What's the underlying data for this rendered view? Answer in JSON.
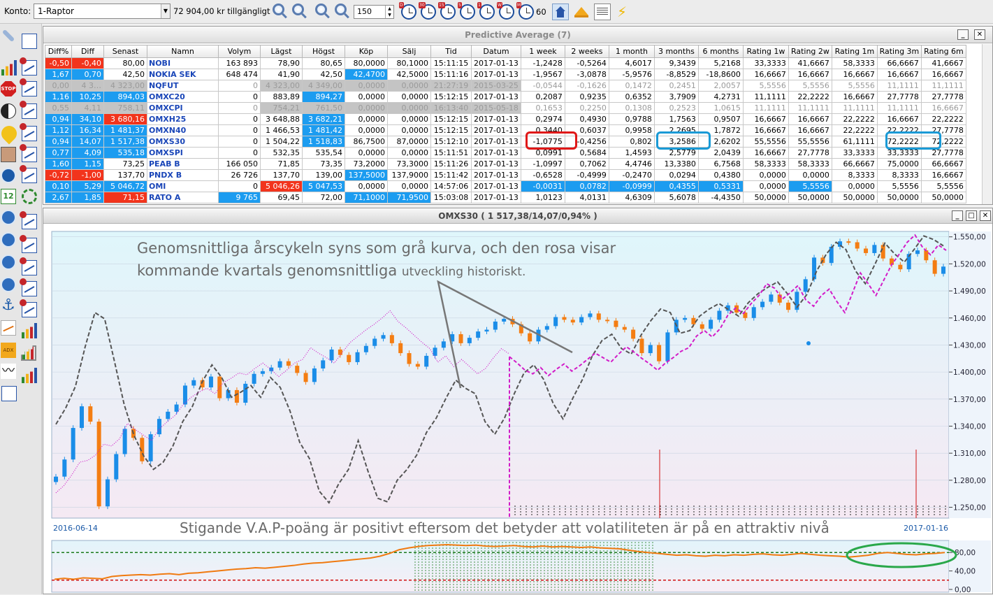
{
  "toolbar": {
    "konto_label": "Konto:",
    "account": "1-Raptor",
    "available": "72 904,00 kr tillgängligt",
    "count_value": "150",
    "clock_badges": [
      "D",
      "30",
      "15",
      "5",
      "1",
      "W",
      "M",
      ""
    ],
    "interval": "60"
  },
  "table_window": {
    "title": "Predictive Average (7)"
  },
  "columns": [
    "Diff%",
    "Diff",
    "Senast",
    "Namn",
    "Volym",
    "Lägst",
    "Högst",
    "Köp",
    "Sälj",
    "Tid",
    "Datum",
    "1 week",
    "2 weeks",
    "1 month",
    "3 months",
    "6 months",
    "Rating 1w",
    "Rating 2w",
    "Rating 1m",
    "Rating 3m",
    "Rating 6m"
  ],
  "rows": [
    {
      "cells": [
        "-0,50",
        "-0,40",
        "80,00",
        "NOBI",
        "163 893",
        "78,90",
        "80,65",
        "80,0000",
        "80,1000",
        "15:11:15",
        "2017-01-13",
        "-1,2428",
        "-0,5264",
        "4,6017",
        "9,3439",
        "5,2168",
        "33,3333",
        "41,6667",
        "58,3333",
        "66,6667",
        "41,6667"
      ],
      "fills": {
        "0": "red",
        "1": "red"
      }
    },
    {
      "cells": [
        "1,67",
        "0,70",
        "42,50",
        "NOKIA SEK",
        "648 474",
        "41,90",
        "42,50",
        "42,4700",
        "42,5000",
        "15:11:16",
        "2017-01-13",
        "-1,9567",
        "-3,0878",
        "-5,9576",
        "-8,8529",
        "-18,8600",
        "16,6667",
        "16,6667",
        "16,6667",
        "16,6667",
        "16,6667"
      ],
      "fills": {
        "0": "blue",
        "1": "blue",
        "7": "blue"
      }
    },
    {
      "cells": [
        "0,00",
        "4 3…",
        "4 323,00",
        "NQFUT",
        "0",
        "4 323,00",
        "4 349,00",
        "0,0000",
        "0,0000",
        "21:27:19",
        "2015-03-25",
        "-0,0544",
        "-0,1626",
        "0,1472",
        "0,2451",
        "2,0057",
        "5,5556",
        "5,5556",
        "5,5556",
        "11,1111",
        "11,1111"
      ],
      "fills": {
        "0": "gray",
        "1": "gray",
        "2": "gray",
        "5": "gray",
        "6": "gray",
        "7": "gray",
        "8": "gray",
        "9": "gray",
        "10": "gray"
      },
      "stale": true
    },
    {
      "cells": [
        "1,16",
        "10,25",
        "894,03",
        "OMXC20",
        "0",
        "883,89",
        "894,27",
        "0,0000",
        "0,0000",
        "15:12:15",
        "2017-01-13",
        "0,2087",
        "0,9235",
        "0,6352",
        "3,7909",
        "4,2731",
        "11,1111",
        "22,2222",
        "16,6667",
        "27,7778",
        "27,7778"
      ],
      "fills": {
        "0": "blue",
        "1": "blue",
        "2": "blue",
        "6": "blue"
      }
    },
    {
      "cells": [
        "0,55",
        "4,11",
        "758,11",
        "OMXCPI",
        "0",
        "754,21",
        "761,50",
        "0,0000",
        "0,0000",
        "16:13:40",
        "2015-05-18",
        "0,1653",
        "0,2250",
        "0,1308",
        "0,2523",
        "1,0615",
        "11,1111",
        "11,1111",
        "11,1111",
        "11,1111",
        "16,6667"
      ],
      "fills": {
        "0": "gray",
        "1": "gray",
        "2": "gray",
        "5": "gray",
        "6": "gray",
        "7": "gray",
        "8": "gray",
        "9": "gray",
        "10": "gray"
      },
      "stale": true
    },
    {
      "cells": [
        "0,94",
        "34,10",
        "3 680,16",
        "OMXH25",
        "0",
        "3 648,88",
        "3 682,21",
        "0,0000",
        "0,0000",
        "15:12:15",
        "2017-01-13",
        "0,2974",
        "0,4930",
        "0,9788",
        "1,7563",
        "0,9507",
        "16,6667",
        "16,6667",
        "22,2222",
        "16,6667",
        "22,2222"
      ],
      "fills": {
        "0": "blue",
        "1": "blue",
        "2": "red",
        "6": "blue"
      }
    },
    {
      "cells": [
        "1,12",
        "16,34",
        "1 481,37",
        "OMXN40",
        "0",
        "1 466,53",
        "1 481,42",
        "0,0000",
        "0,0000",
        "15:12:15",
        "2017-01-13",
        "0,3440",
        "0,6037",
        "0,9958",
        "2,2695",
        "1,7872",
        "16,6667",
        "16,6667",
        "22,2222",
        "22,2222",
        "27,7778"
      ],
      "fills": {
        "0": "blue",
        "1": "blue",
        "2": "blue",
        "6": "blue"
      }
    },
    {
      "cells": [
        "0,94",
        "14,07",
        "1 517,38",
        "OMXS30",
        "0",
        "1 504,22",
        "1 518,83",
        "86,7500",
        "87,0000",
        "15:12:10",
        "2017-01-13",
        "-1,0775",
        "-0,4256",
        "0,802",
        "3,2586",
        "2,6202",
        "55,5556",
        "55,5556",
        "61,1111",
        "72,2222",
        "72,2222"
      ],
      "fills": {
        "0": "blue",
        "1": "blue",
        "2": "blue",
        "6": "blue"
      },
      "selected": true
    },
    {
      "cells": [
        "0,77",
        "4,09",
        "535,18",
        "OMXSPI",
        "0",
        "532,35",
        "535,54",
        "0,0000",
        "0,0000",
        "15:11:51",
        "2017-01-13",
        "0,0991",
        "0,5684",
        "1,4593",
        "2,5779",
        "2,0439",
        "16,6667",
        "27,7778",
        "33,3333",
        "33,3333",
        "27,7778"
      ],
      "fills": {
        "0": "blue",
        "1": "blue",
        "2": "blue"
      }
    },
    {
      "cells": [
        "1,60",
        "1,15",
        "73,25",
        "PEAB B",
        "166 050",
        "71,85",
        "73,35",
        "73,2000",
        "73,3000",
        "15:11:26",
        "2017-01-13",
        "-1,0997",
        "0,7062",
        "4,4746",
        "13,3380",
        "6,7568",
        "58,3333",
        "58,3333",
        "66,6667",
        "75,0000",
        "66,6667"
      ],
      "fills": {
        "0": "blue",
        "1": "blue"
      }
    },
    {
      "cells": [
        "-0,72",
        "-1,00",
        "137,70",
        "PNDX B",
        "26 726",
        "137,70",
        "139,00",
        "137,5000",
        "137,9000",
        "15:11:42",
        "2017-01-13",
        "-0,6528",
        "-0,4999",
        "-0,2470",
        "0,0294",
        "0,4380",
        "0,0000",
        "0,0000",
        "8,3333",
        "8,3333",
        "16,6667"
      ],
      "fills": {
        "0": "red",
        "1": "red",
        "7": "blue"
      }
    },
    {
      "cells": [
        "0,10",
        "5,29",
        "5 046,72",
        "OMI",
        "0",
        "5 046,26",
        "5 047,53",
        "0,0000",
        "0,0000",
        "14:57:06",
        "2017-01-13",
        "-0,0031",
        "0,0782",
        "-0,0999",
        "0,4355",
        "0,5331",
        "0,0000",
        "5,5556",
        "0,0000",
        "5,5556",
        "5,5556"
      ],
      "fills": {
        "0": "blue",
        "1": "blue",
        "2": "blue",
        "5": "red",
        "6": "blue",
        "11": "blue",
        "12": "blue",
        "13": "blue",
        "14": "blue",
        "15": "blue",
        "17": "blue"
      }
    },
    {
      "cells": [
        "2,67",
        "1,85",
        "71,15",
        "RATO A",
        "9 765",
        "69,45",
        "72,00",
        "71,1000",
        "71,9500",
        "15:03:08",
        "2017-01-13",
        "1,0123",
        "4,0131",
        "4,6309",
        "5,6078",
        "-4,4350",
        "50,0000",
        "50,0000",
        "50,0000",
        "50,0000",
        "50,0000"
      ],
      "fills": {
        "0": "blue",
        "1": "blue",
        "2": "red",
        "4": "blue",
        "7": "blue",
        "8": "blue"
      }
    }
  ],
  "chart_window": {
    "title": "OMXS30 ( 1 517,38/14,07/0,94% )"
  },
  "annotations": {
    "main_line1": "Genomsnittliga årscykeln syns som grå kurva, och den rosa visar",
    "main_line2a": "kommande kvartals genomsnittliga ",
    "main_line2b": "utveckling historiskt.",
    "vap": "Stigande V.A.P-poäng är positivt eftersom det betyder att volatiliteten är på en attraktiv nivå"
  },
  "chart_data": {
    "type": "candlestick",
    "x_start": "2016-06-14",
    "x_end": "2017-01-16",
    "ylim": [
      1238,
      1556
    ],
    "yticks": [
      1250,
      1280,
      1310,
      1340,
      1370,
      1400,
      1430,
      1460,
      1490,
      1520,
      1550
    ],
    "ytick_labels": [
      "1.250,00",
      "1.280,00",
      "1.310,00",
      "1.340,00",
      "1.370,00",
      "1.400,00",
      "1.430,00",
      "1.460,00",
      "1.490,00",
      "1.520,00",
      "1.550,00"
    ],
    "closes": [
      1284,
      1303,
      1338,
      1362,
      1345,
      1251,
      1281,
      1309,
      1337,
      1327,
      1301,
      1331,
      1348,
      1356,
      1364,
      1385,
      1391,
      1383,
      1395,
      1371,
      1380,
      1366,
      1387,
      1398,
      1401,
      1405,
      1412,
      1407,
      1399,
      1389,
      1404,
      1413,
      1425,
      1419,
      1411,
      1422,
      1429,
      1437,
      1441,
      1432,
      1421,
      1409,
      1406,
      1418,
      1427,
      1434,
      1442,
      1432,
      1438,
      1445,
      1447,
      1456,
      1459,
      1453,
      1443,
      1434,
      1447,
      1451,
      1461,
      1458,
      1455,
      1461,
      1465,
      1458,
      1457,
      1450,
      1447,
      1437,
      1421,
      1430,
      1412,
      1444,
      1458,
      1460,
      1453,
      1448,
      1458,
      1468,
      1474,
      1466,
      1460,
      1472,
      1478,
      1486,
      1477,
      1469,
      1489,
      1503,
      1527,
      1521,
      1539,
      1545,
      1544,
      1537,
      1532,
      1541,
      1526,
      1519,
      1514,
      1531,
      1535,
      1524,
      1509,
      1517
    ],
    "gray_avg": [
      1342,
      1360,
      1384,
      1428,
      1466,
      1459,
      1412,
      1364,
      1330,
      1307,
      1292,
      1300,
      1318,
      1345,
      1362,
      1389,
      1408,
      1394,
      1372,
      1378,
      1385,
      1372,
      1394,
      1383,
      1357,
      1322,
      1304,
      1268,
      1255,
      1276,
      1292,
      1324,
      1290,
      1260,
      1256,
      1280,
      1292,
      1308,
      1333,
      1349,
      1371,
      1391,
      1382,
      1376,
      1345,
      1331,
      1349,
      1376,
      1399,
      1408,
      1392,
      1365,
      1348,
      1371,
      1392,
      1418,
      1435,
      1442,
      1426,
      1420,
      1441,
      1457,
      1470,
      1466,
      1443,
      1446,
      1462,
      1470,
      1476,
      1469,
      1462,
      1477,
      1487,
      1494,
      1500,
      1487,
      1472,
      1486,
      1512,
      1531,
      1544,
      1536,
      1512,
      1498,
      1520,
      1543,
      1531,
      1522,
      1536,
      1551,
      1547,
      1540
    ],
    "pink_hist": [
      1266,
      1274,
      1286,
      1300,
      1302,
      1308,
      1320,
      1318,
      1326,
      1343,
      1336,
      1330,
      1324,
      1337,
      1345,
      1352,
      1364,
      1372,
      1378,
      1382,
      1376,
      1388,
      1393,
      1399,
      1397,
      1404,
      1410,
      1403,
      1395,
      1402,
      1410,
      1414,
      1427,
      1421,
      1416,
      1410,
      1422,
      1433,
      1440,
      1447,
      1453,
      1460,
      1468,
      1456,
      1449,
      1441,
      1433,
      1426,
      1411,
      1418,
      1406,
      1414,
      1406,
      1398,
      1404,
      1416,
      1426,
      1420
    ],
    "pink_future": [
      1417,
      1410,
      1402,
      1398,
      1405,
      1396,
      1403,
      1409,
      1401,
      1407,
      1414,
      1421,
      1416,
      1411,
      1420,
      1428,
      1422,
      1415,
      1409,
      1402,
      1410,
      1416,
      1423,
      1427,
      1440,
      1446,
      1439,
      1448,
      1463,
      1471,
      1465,
      1476,
      1485,
      1498,
      1493,
      1481,
      1488,
      1496,
      1480,
      1473,
      1485,
      1492,
      1478,
      1466,
      1488,
      1510,
      1498,
      1485,
      1502,
      1519,
      1531,
      1544,
      1552,
      1538,
      1530,
      1541,
      1535
    ],
    "vap": [
      22,
      24,
      22,
      25,
      24,
      23,
      28,
      30,
      31,
      32,
      31,
      33,
      34,
      32,
      35,
      36,
      38,
      40,
      42,
      44,
      45,
      47,
      46,
      48,
      50,
      52,
      55,
      57,
      58,
      60,
      62,
      64,
      66,
      68,
      72,
      78,
      86,
      90,
      93,
      95,
      96,
      97,
      96,
      95,
      96,
      94,
      93,
      94,
      95,
      93,
      92,
      94,
      92,
      93,
      92,
      91,
      92,
      90,
      89,
      88,
      85,
      82,
      80,
      78,
      76,
      74,
      75,
      73,
      72,
      74,
      73,
      75,
      74,
      76,
      77,
      75,
      74,
      76,
      78,
      76,
      74,
      73,
      72,
      70,
      72,
      74,
      78,
      80,
      78,
      76,
      75,
      77,
      78,
      80
    ]
  },
  "vap_scale": [
    "80,00",
    "40,00",
    "0,00"
  ],
  "colors": {
    "up": "#1a8de8",
    "down": "#f47d12",
    "gray_line": "#555555",
    "pink_line": "#d21cc8",
    "cell_red": "#f2341c",
    "cell_blue": "#1c9cf0"
  }
}
